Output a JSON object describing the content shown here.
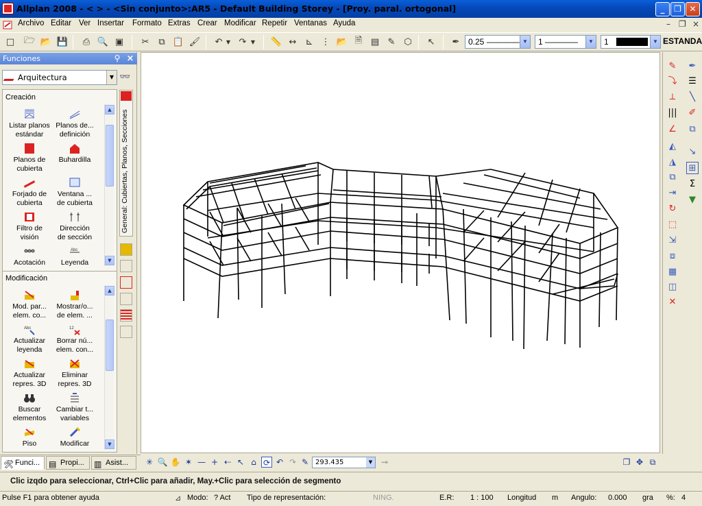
{
  "window": {
    "title": "Allplan 2008 - <      > - <Sin conjunto>:AR5 - Default Building Storey - [Proy. paral. ortogonal]",
    "minimize": "_",
    "restore": "❐",
    "close": "✕"
  },
  "menu": {
    "items": [
      "Archivo",
      "Editar",
      "Ver",
      "Insertar",
      "Formato",
      "Extras",
      "Crear",
      "Modificar",
      "Repetir",
      "Ventanas",
      "Ayuda"
    ],
    "mdi_min": "–",
    "mdi_restore": "❐",
    "mdi_close": "×"
  },
  "toolbar": {
    "pen_thickness": "0.25 ————",
    "line_type": "1 ————",
    "color_number": "1",
    "layer_label": "ESTANDA"
  },
  "panel": {
    "title": "Funciones",
    "family": "Arquitectura",
    "vertical_tab": "General: Cubiertas, Planos, Secciones",
    "creation_title": "Creación",
    "creation_items": [
      {
        "l1": "Listar planos",
        "l2": "estándar"
      },
      {
        "l1": "Planos de...",
        "l2": "definición"
      },
      {
        "l1": "Planos de",
        "l2": "cubierta"
      },
      {
        "l1": "Buhardilla",
        "l2": ""
      },
      {
        "l1": "Forjado de",
        "l2": "cubierta"
      },
      {
        "l1": "Ventana ...",
        "l2": "de cubierta"
      },
      {
        "l1": "Filtro de",
        "l2": "visión"
      },
      {
        "l1": "Dirección",
        "l2": "de sección"
      },
      {
        "l1": "Acotación",
        "l2": ""
      },
      {
        "l1": "Leyenda",
        "l2": ""
      }
    ],
    "modify_title": "Modificación",
    "modify_items": [
      {
        "l1": "Mod. par...",
        "l2": "elem. co..."
      },
      {
        "l1": "Mostrar/o...",
        "l2": "de elem. ..."
      },
      {
        "l1": "Actualizar",
        "l2": "leyenda"
      },
      {
        "l1": "Borrar nú...",
        "l2": "elem. con..."
      },
      {
        "l1": "Actualizar",
        "l2": "repres. 3D"
      },
      {
        "l1": "Eliminar",
        "l2": "repres. 3D"
      },
      {
        "l1": "Buscar",
        "l2": "elementos"
      },
      {
        "l1": "Cambiar t...",
        "l2": "variables"
      },
      {
        "l1": "Piso",
        "l2": ""
      },
      {
        "l1": "Modificar",
        "l2": ""
      }
    ]
  },
  "bottom_tabs": [
    "Funci...",
    "Propi...",
    "Asist..."
  ],
  "viewbar": {
    "zoom_value": "293.435"
  },
  "prompt": "Clic izqdo para seleccionar, Ctrl+Clic para añadir, May.+Clic para selección de segmento",
  "status": {
    "help": "Pulse F1 para obtener ayuda",
    "mode": "Modo:",
    "mode_value": "? Act",
    "repr": "Tipo de representación:",
    "repr_value": "NING.",
    "scale_label": "E.R:",
    "scale_value": "1 : 100",
    "length_label": "Longitud",
    "length_unit": "m",
    "angle_label": "Angulo:",
    "angle_value": "0.000",
    "angle_unit": "gra",
    "percent_label": "%:",
    "percent_value": "4"
  },
  "colors": {
    "titlebar": "#0548b8",
    "accent_red": "#cc2222",
    "panel_bg": "#ece9d8"
  }
}
